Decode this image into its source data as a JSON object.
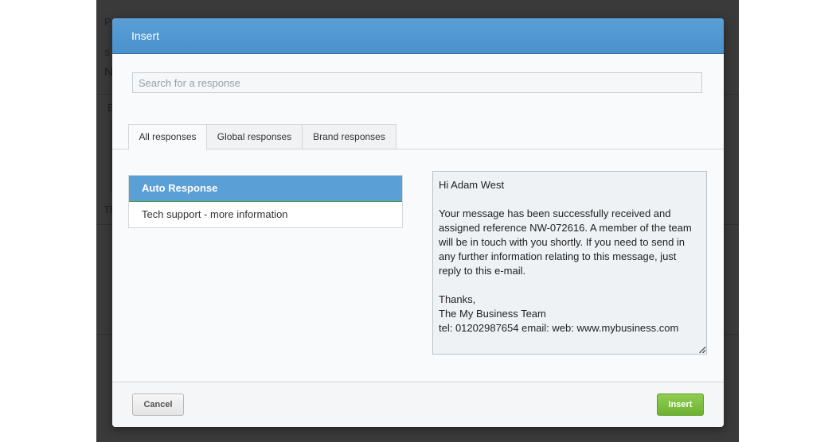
{
  "background": {
    "fragments": [
      "P",
      "S",
      "N",
      "E",
      "Th"
    ]
  },
  "modal": {
    "title": "Insert",
    "search": {
      "placeholder": "Search for a response",
      "value": ""
    },
    "tabs": [
      {
        "label": "All responses",
        "active": true
      },
      {
        "label": "Global responses",
        "active": false
      },
      {
        "label": "Brand responses",
        "active": false
      }
    ],
    "responses": [
      {
        "label": "Auto Response",
        "selected": true
      },
      {
        "label": "Tech support - more information",
        "selected": false
      }
    ],
    "preview": {
      "greeting": "Hi Adam West",
      "body": "Your message has been successfully received and assigned reference NW-072616. A member of the team will be in touch with you shortly. If you need to send in any further information relating to this message, just reply to this e-mail.",
      "signoff": "Thanks,",
      "team": "The My Business Team",
      "contact": "tel: 01202987654 email:  web: www.mybusiness.com"
    },
    "footer": {
      "cancel_label": "Cancel",
      "insert_label": "Insert"
    }
  },
  "colors": {
    "header_blue": "#4a91cd",
    "selected_item": "#5a9fd6",
    "insert_green": "#6eb232"
  }
}
